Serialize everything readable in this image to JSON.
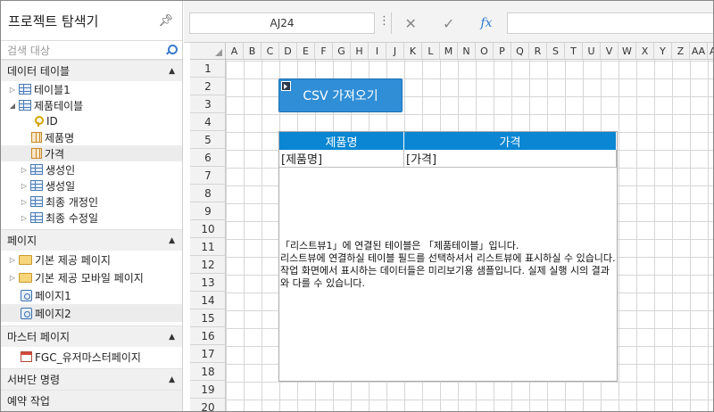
{
  "explorer": {
    "title": "프로젝트 탐색기",
    "pin_icon": "pin-icon",
    "search_placeholder": "검색 대상",
    "sections": {
      "data_tables": "데이터 테이블",
      "pages": "페이지",
      "master_pages": "마스터 페이지",
      "server_commands": "서버단 명령",
      "scheduled_tasks": "예약 작업"
    },
    "tables": [
      {
        "label": "테이블1"
      },
      {
        "label": "제품테이블"
      }
    ],
    "fields": [
      {
        "label": "ID",
        "icon": "key-icon"
      },
      {
        "label": "제품명",
        "icon": "column-icon"
      },
      {
        "label": "가격",
        "icon": "column-icon"
      },
      {
        "label": "생성인",
        "icon": "table-icon"
      },
      {
        "label": "생성일",
        "icon": "table-icon"
      },
      {
        "label": "최종 개정인",
        "icon": "table-icon"
      },
      {
        "label": "최종 수정일",
        "icon": "table-icon"
      }
    ],
    "pages": [
      {
        "label": "기본 제공 페이지"
      },
      {
        "label": "기본 제공 모바일 페이지"
      },
      {
        "label": "페이지1"
      },
      {
        "label": "페이지2"
      }
    ],
    "master_pages": [
      {
        "label": "FGC_유저마스터페이지"
      }
    ]
  },
  "formula_bar": {
    "cell_ref": "AJ24",
    "dots": "⋮",
    "cancel": "✕",
    "confirm": "✓",
    "fx": "fx"
  },
  "grid": {
    "columns": [
      "A",
      "B",
      "C",
      "D",
      "E",
      "F",
      "G",
      "H",
      "I",
      "J",
      "K",
      "L",
      "M",
      "N",
      "O",
      "P",
      "Q",
      "R",
      "S",
      "T",
      "U",
      "V",
      "W",
      "X",
      "Y",
      "Z",
      "AA",
      "AB"
    ],
    "rows": [
      "1",
      "2",
      "3",
      "4",
      "5",
      "6",
      "7",
      "8",
      "9",
      "10",
      "11",
      "12",
      "13",
      "14",
      "15",
      "16",
      "17",
      "18",
      "19",
      "20"
    ]
  },
  "csv_button": {
    "label": "CSV 가져오기"
  },
  "listview": {
    "headers": [
      "제품명",
      "가격"
    ],
    "row": [
      "[제품명]",
      "[가격]"
    ],
    "message": "「리스트뷰1」에 연결된 테이블은 「제품테이블」입니다.\n리스트뷰에 연결하실 테이블 필드를 선택하셔서 리스트뷰에 표시하실 수 있습니다.\n작업 화면에서 표시하는 데이터들은 미리보기용 샘플입니다. 실제 실행 시의 결과와 다를 수 있습니다."
  },
  "colors": {
    "accent": "#0a86d2",
    "button": "#2f8ed6"
  }
}
